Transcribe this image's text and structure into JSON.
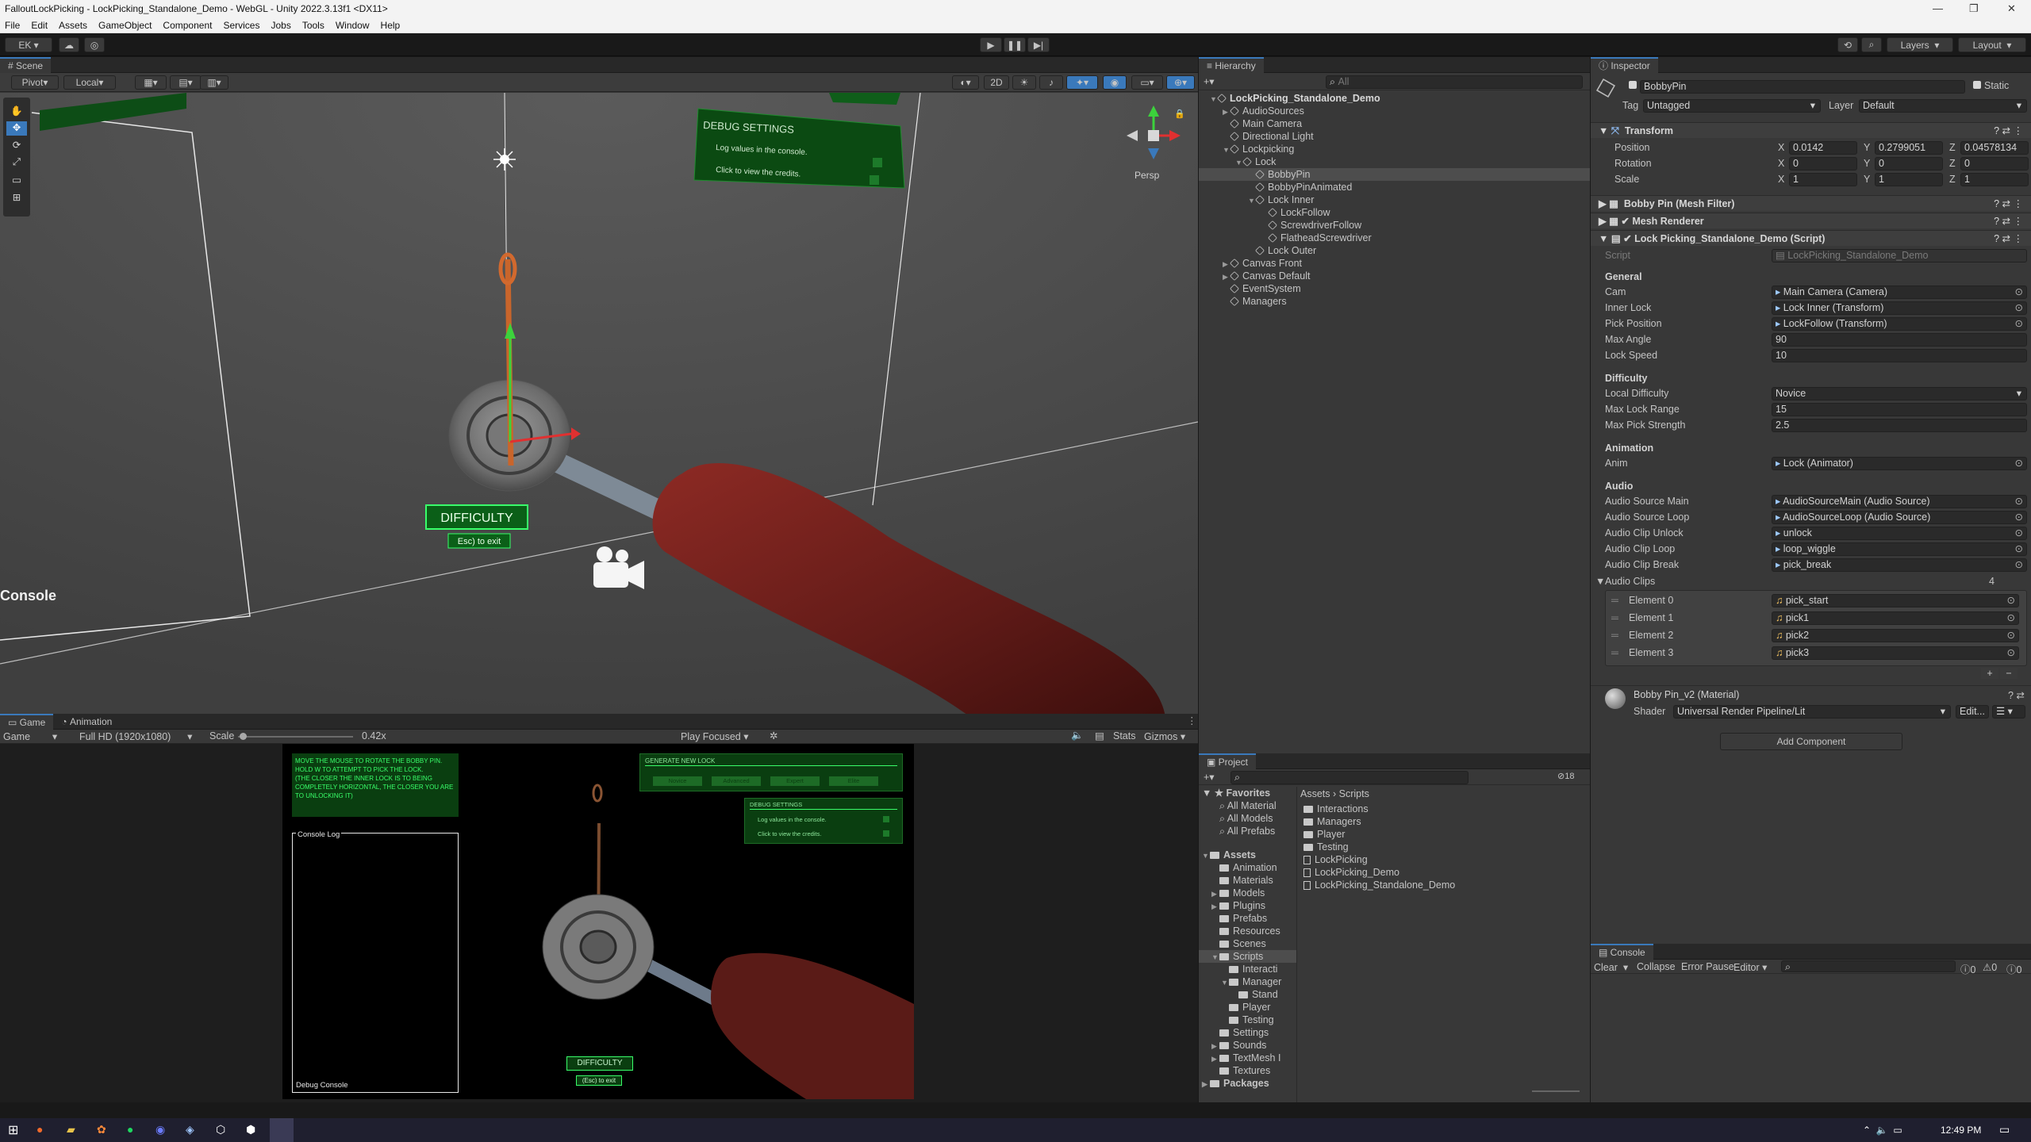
{
  "window": {
    "title": "FalloutLockPicking - LockPicking_Standalone_Demo - WebGL - Unity 2022.3.13f1 <DX11>"
  },
  "menu": [
    "File",
    "Edit",
    "Assets",
    "GameObject",
    "Component",
    "Services",
    "Jobs",
    "Tools",
    "Window",
    "Help"
  ],
  "toolbar": {
    "account": "EK",
    "layers": "Layers",
    "layout": "Layout"
  },
  "scene": {
    "tab": "Scene",
    "pivot": "Pivot",
    "local": "Local",
    "mode2d": "2D",
    "persp": "Persp",
    "debug_title": "DEBUG SETTINGS",
    "debug_log": "Log values in the console.",
    "debug_credits": "Click to view the credits.",
    "difficulty": "DIFFICULTY",
    "esc": "Esc) to exit",
    "console": "Console"
  },
  "game": {
    "tabs": [
      "Game",
      "Animation"
    ],
    "display": "Game",
    "resolution": "Full HD (1920x1080)",
    "scale_label": "Scale",
    "scale_value": "0.42x",
    "play_focused": "Play Focused",
    "stats": "Stats",
    "gizmos": "Gizmos",
    "instructions": [
      "MOVE THE MOUSE TO ROTATE THE BOBBY PIN.",
      "HOLD W TO ATTEMPT TO PICK THE LOCK.",
      "(THE CLOSER THE INNER LOCK IS TO BEING COMPLETELY HORIZONTAL, THE CLOSER YOU ARE TO UNLOCKING IT)"
    ],
    "console_log": "Console Log",
    "debug_console": "Debug Console",
    "generate_new_lock": "GENERATE NEW LOCK",
    "lock_buttons": [
      "Novice",
      "Advanced",
      "Expert",
      "Elite"
    ],
    "debug_title": "DEBUG SETTINGS",
    "debug_log": "Log values in the console.",
    "debug_credits": "Click to view the credits.",
    "difficulty": "DIFFICULTY",
    "esc": "(Esc) to exit"
  },
  "hierarchy": {
    "tab": "Hierarchy",
    "search_placeholder": "All",
    "items": [
      {
        "label": "LockPicking_Standalone_Demo",
        "depth": 0,
        "fold": "▼",
        "scene": true
      },
      {
        "label": "AudioSources",
        "depth": 1,
        "fold": "▶"
      },
      {
        "label": "Main Camera",
        "depth": 1,
        "fold": ""
      },
      {
        "label": "Directional Light",
        "depth": 1,
        "fold": ""
      },
      {
        "label": "Lockpicking",
        "depth": 1,
        "fold": "▼"
      },
      {
        "label": "Lock",
        "depth": 2,
        "fold": "▼"
      },
      {
        "label": "BobbyPin",
        "depth": 3,
        "fold": "",
        "selected": true
      },
      {
        "label": "BobbyPinAnimated",
        "depth": 3,
        "fold": ""
      },
      {
        "label": "Lock Inner",
        "depth": 3,
        "fold": "▼"
      },
      {
        "label": "LockFollow",
        "depth": 4,
        "fold": ""
      },
      {
        "label": "ScrewdriverFollow",
        "depth": 4,
        "fold": ""
      },
      {
        "label": "FlatheadScrewdriver",
        "depth": 4,
        "fold": ""
      },
      {
        "label": "Lock Outer",
        "depth": 3,
        "fold": ""
      },
      {
        "label": "Canvas Front",
        "depth": 1,
        "fold": "▶"
      },
      {
        "label": "Canvas Default",
        "depth": 1,
        "fold": "▶"
      },
      {
        "label": "EventSystem",
        "depth": 1,
        "fold": ""
      },
      {
        "label": "Managers",
        "depth": 1,
        "fold": ""
      }
    ]
  },
  "project": {
    "tab": "Project",
    "breadcrumb": [
      "Assets",
      "Scripts"
    ],
    "count": "18",
    "favorites": "Favorites",
    "favorite_items": [
      "All Material",
      "All Models",
      "All Prefabs"
    ],
    "tree": [
      {
        "label": "Assets",
        "depth": 0,
        "fold": "▼",
        "bold": true
      },
      {
        "label": "Animation",
        "depth": 1,
        "fold": ""
      },
      {
        "label": "Materials",
        "depth": 1,
        "fold": ""
      },
      {
        "label": "Models",
        "depth": 1,
        "fold": "▶"
      },
      {
        "label": "Plugins",
        "depth": 1,
        "fold": "▶"
      },
      {
        "label": "Prefabs",
        "depth": 1,
        "fold": ""
      },
      {
        "label": "Resources",
        "depth": 1,
        "fold": ""
      },
      {
        "label": "Scenes",
        "depth": 1,
        "fold": ""
      },
      {
        "label": "Scripts",
        "depth": 1,
        "fold": "▼",
        "selected": true
      },
      {
        "label": "Interacti",
        "depth": 2,
        "fold": ""
      },
      {
        "label": "Manager",
        "depth": 2,
        "fold": "▼"
      },
      {
        "label": "Stand",
        "depth": 3,
        "fold": ""
      },
      {
        "label": "Player",
        "depth": 2,
        "fold": ""
      },
      {
        "label": "Testing",
        "depth": 2,
        "fold": ""
      },
      {
        "label": "Settings",
        "depth": 1,
        "fold": ""
      },
      {
        "label": "Sounds",
        "depth": 1,
        "fold": "▶"
      },
      {
        "label": "TextMesh I",
        "depth": 1,
        "fold": "▶"
      },
      {
        "label": "Textures",
        "depth": 1,
        "fold": ""
      },
      {
        "label": "Packages",
        "depth": 0,
        "fold": "▶",
        "bold": true
      }
    ],
    "files": [
      {
        "label": "Interactions",
        "type": "folder"
      },
      {
        "label": "Managers",
        "type": "folder"
      },
      {
        "label": "Player",
        "type": "folder"
      },
      {
        "label": "Testing",
        "type": "folder"
      },
      {
        "label": "LockPicking",
        "type": "script"
      },
      {
        "label": "LockPicking_Demo",
        "type": "script"
      },
      {
        "label": "LockPicking_Standalone_Demo",
        "type": "script"
      }
    ]
  },
  "inspector": {
    "tab": "Inspector",
    "object_name": "BobbyPin",
    "static": "Static",
    "tag_label": "Tag",
    "tag_value": "Untagged",
    "layer_label": "Layer",
    "layer_value": "Default",
    "transform": "Transform",
    "position_label": "Position",
    "rotation_label": "Rotation",
    "scale_label": "Scale",
    "position": [
      "0.0142",
      "0.2799051",
      "0.04578134"
    ],
    "rotation": [
      "0",
      "0",
      "0"
    ],
    "scale": [
      "1",
      "1",
      "1"
    ],
    "components": [
      "Bobby Pin (Mesh Filter)",
      "Mesh Renderer",
      "Lock Picking_Standalone_Demo (Script)"
    ],
    "script_label": "Script",
    "script_value": "LockPicking_Standalone_Demo",
    "sections": [
      {
        "header": "General",
        "fields": [
          {
            "label": "Cam",
            "value": "Main Camera (Camera)",
            "ref": true
          },
          {
            "label": "Inner Lock",
            "value": "Lock Inner (Transform)",
            "ref": true
          },
          {
            "label": "Pick Position",
            "value": "LockFollow (Transform)",
            "ref": true
          },
          {
            "label": "Max Angle",
            "value": "90"
          },
          {
            "label": "Lock Speed",
            "value": "10"
          }
        ]
      },
      {
        "header": "Difficulty",
        "fields": [
          {
            "label": "Local Difficulty",
            "value": "Novice",
            "dropdown": true
          },
          {
            "label": "Max Lock Range",
            "value": "15"
          },
          {
            "label": "Max Pick Strength",
            "value": "2.5"
          }
        ]
      },
      {
        "header": "Animation",
        "fields": [
          {
            "label": "Anim",
            "value": "Lock (Animator)",
            "ref": true
          }
        ]
      },
      {
        "header": "Audio",
        "fields": [
          {
            "label": "Audio Source Main",
            "value": "AudioSourceMain (Audio Source)",
            "ref": true
          },
          {
            "label": "Audio Source Loop",
            "value": "AudioSourceLoop (Audio Source)",
            "ref": true
          },
          {
            "label": "Audio Clip Unlock",
            "value": "unlock",
            "ref": true
          },
          {
            "label": "Audio Clip Loop",
            "value": "loop_wiggle",
            "ref": true
          },
          {
            "label": "Audio Clip Break",
            "value": "pick_break",
            "ref": true
          }
        ]
      }
    ],
    "audio_clips_label": "Audio Clips",
    "audio_clips_count": "4",
    "elements": [
      {
        "label": "Element 0",
        "value": "pick_start"
      },
      {
        "label": "Element 1",
        "value": "pick1"
      },
      {
        "label": "Element 2",
        "value": "pick2"
      },
      {
        "label": "Element 3",
        "value": "pick3"
      }
    ],
    "material_name": "Bobby Pin_v2 (Material)",
    "shader_label": "Shader",
    "shader_value": "Universal Render Pipeline/Lit",
    "edit": "Edit...",
    "add_component": "Add Component"
  },
  "console": {
    "tab": "Console",
    "clear": "Clear",
    "collapse": "Collapse",
    "error_pause": "Error Pause",
    "editor": "Editor",
    "counts": [
      "0",
      "0",
      "0"
    ]
  },
  "taskbar": {
    "time": "12:49 PM"
  },
  "colors": {
    "accent": "#3a79bb",
    "selection": "#2c5d87",
    "terminal_green": "#39ff6a"
  }
}
